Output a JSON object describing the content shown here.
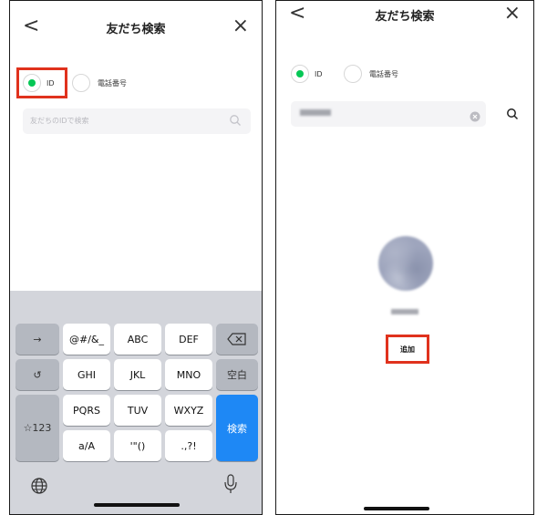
{
  "left_screen": {
    "header": {
      "back": "<",
      "title": "友だち検索",
      "close": "×"
    },
    "options": {
      "id_label": "ID",
      "phone_label": "電話番号",
      "selected": "ID"
    },
    "search": {
      "placeholder": "友だちのIDで検索"
    },
    "keyboard": {
      "arrow": "→",
      "k1": "@#/&_",
      "k2": "ABC",
      "k3": "DEF",
      "undo": "↺",
      "k4": "GHI",
      "k5": "JKL",
      "k6": "MNO",
      "space": "空白",
      "num": "☆123",
      "k7": "PQRS",
      "k8": "TUV",
      "k9": "WXYZ",
      "search": "検索",
      "k10": "a/A",
      "k11": "'\"()",
      "k12": ".,?!"
    }
  },
  "right_screen": {
    "header": {
      "back": "<",
      "title": "友だち検索",
      "close": "×"
    },
    "options": {
      "id_label": "ID",
      "phone_label": "電話番号",
      "selected": "ID"
    },
    "add_button": "追加"
  },
  "colors": {
    "accent_green": "#06c755",
    "highlight_red": "#e0321d",
    "search_key_blue": "#1e88f5"
  }
}
